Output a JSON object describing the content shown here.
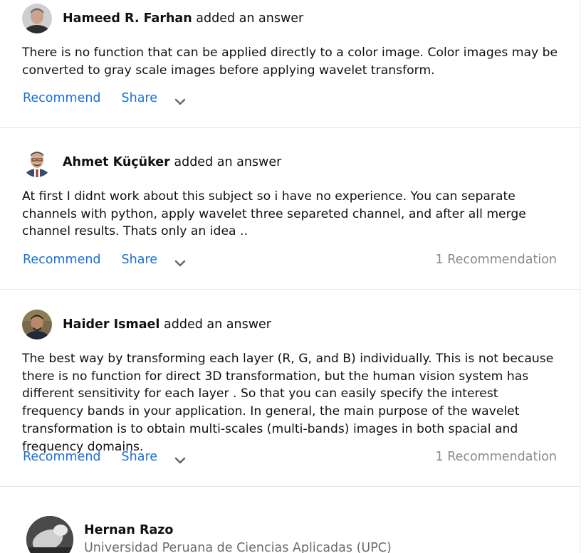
{
  "answers": [
    {
      "author": "Hameed R. Farhan",
      "action": "added an answer",
      "body": "There is no function that can be applied directly to a color image. Color images may be converted to gray scale images before applying wavelet transform.",
      "recommend_label": "Recommend",
      "share_label": "Share",
      "recommendations": ""
    },
    {
      "author": "Ahmet Küçüker",
      "action": "added an answer",
      "body": "At first I didnt work about this subject so i have no experience. You can separate channels with python, apply wavelet three separeted channel, and after all merge channel results. Thats only an idea ..",
      "recommend_label": "Recommend",
      "share_label": "Share",
      "recommendations": "1 Recommendation"
    },
    {
      "author": "Haider Ismael",
      "action": "added an answer",
      "body": "The best way by transforming each layer (R, G, and B) individually. This is not because there is no function for direct 3D transformation, but the human vision system has different sensitivity for each layer . So that you can easily specify the interest frequency bands in your application. In general, the main purpose of the wavelet transformation is to obtain multi-scales (multi-bands) images in both spacial and frequency domains.",
      "recommend_label": "Recommend",
      "share_label": "Share",
      "recommendations": "1 Recommendation"
    }
  ],
  "next_author": {
    "name": "Hernan Razo",
    "affiliation": "Universidad Peruana de Ciencias Aplicadas (UPC)"
  },
  "colors": {
    "link": "#1b6fd1",
    "muted": "#8a8a8a",
    "divider": "#e6e6e6"
  }
}
